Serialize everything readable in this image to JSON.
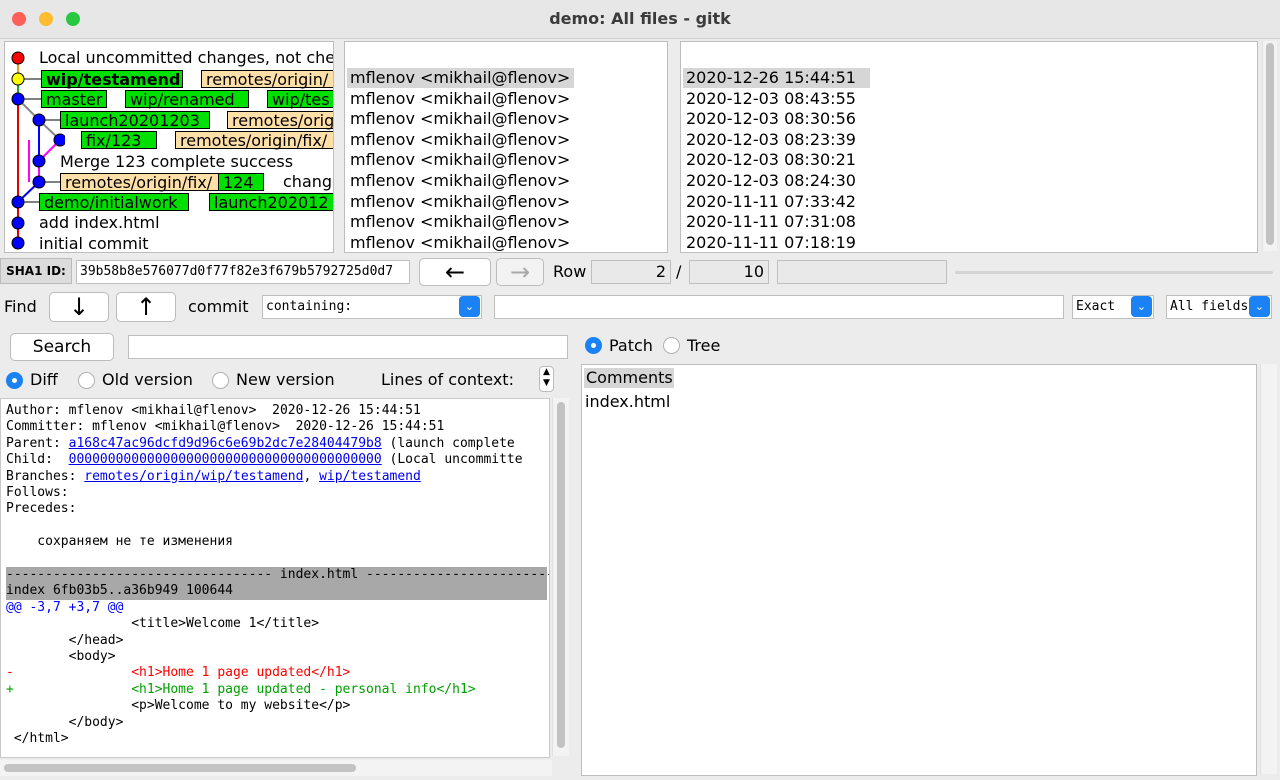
{
  "window": {
    "title": "demo: All files - gitk"
  },
  "commits": [
    {
      "subject": "Local uncommitted changes, not che",
      "author": "",
      "date": ""
    },
    {
      "subject": "",
      "author": "mflenov <mikhail@flenov>",
      "date": "2020-12-26 15:44:51",
      "refs": [
        {
          "label": "wip/testamend",
          "kind": "head"
        },
        {
          "label": "remotes/origin/",
          "kind": "remote"
        }
      ]
    },
    {
      "subject": "",
      "author": "mflenov <mikhail@flenov>",
      "date": "2020-12-03 08:43:55",
      "refs": [
        {
          "label": "master",
          "kind": "head"
        },
        {
          "label": "wip/renamed",
          "kind": "head"
        },
        {
          "label": "wip/tes",
          "kind": "head"
        }
      ]
    },
    {
      "subject": "",
      "author": "mflenov <mikhail@flenov>",
      "date": "2020-12-03 08:30:56",
      "refs": [
        {
          "label": "launch20201203",
          "kind": "head"
        },
        {
          "label": "remotes/origi",
          "kind": "remote"
        }
      ]
    },
    {
      "subject": "",
      "author": "mflenov <mikhail@flenov>",
      "date": "2020-12-03 08:23:39",
      "refs": [
        {
          "label": "fix/123",
          "kind": "head"
        },
        {
          "label": "remotes/origin/fix/",
          "kind": "remote"
        }
      ]
    },
    {
      "subject": "Merge 123 complete success",
      "author": "mflenov <mikhail@flenov>",
      "date": "2020-12-03 08:30:21"
    },
    {
      "subject": "change",
      "author": "mflenov <mikhail@flenov>",
      "date": "2020-12-03 08:24:30",
      "refs": [
        {
          "label": "remotes/origin/fix/",
          "kind": "remote"
        },
        {
          "label": "124",
          "kind": "head"
        }
      ]
    },
    {
      "subject": "",
      "author": "mflenov <mikhail@flenov>",
      "date": "2020-11-11 07:33:42",
      "refs": [
        {
          "label": "demo/initialwork",
          "kind": "head"
        },
        {
          "label": "launch202012",
          "kind": "head"
        }
      ]
    },
    {
      "subject": "add index.html",
      "author": "mflenov <mikhail@flenov>",
      "date": "2020-11-11 07:31:08"
    },
    {
      "subject": "initial commit",
      "author": "mflenov <mikhail@flenov>",
      "date": "2020-11-11 07:18:19"
    }
  ],
  "sha_bar": {
    "label": "SHA1 ID:",
    "value": "39b58b8e576077d0f77f82e3f679b5792725d0d7",
    "back_glyph": "←",
    "forward_glyph": "→",
    "row_label": "Row",
    "row_current": "2",
    "row_sep": "/",
    "row_total": "10"
  },
  "find_bar": {
    "find_label": "Find",
    "down_glyph": "↓",
    "up_glyph": "↑",
    "commit_label": "commit",
    "containing": "containing:",
    "exact": "Exact",
    "all_fields": "All fields"
  },
  "search": {
    "button": "Search"
  },
  "diff_options": {
    "diff": "Diff",
    "old_version": "Old version",
    "new_version": "New version",
    "lines_of_context": "Lines of context:"
  },
  "details": {
    "author_label": "Author:",
    "author": "mflenov <mikhail@flenov>  2020-12-26 15:44:51",
    "committer_label": "Committer:",
    "committer": "mflenov <mikhail@flenov>  2020-12-26 15:44:51",
    "parent_label": "Parent:",
    "parent_sha": "a168c47ac96dcfd9d96c6e69b2dc7e28404479b8",
    "parent_desc": " (launch complete",
    "child_label": "Child:",
    "child_sha": "0000000000000000000000000000000000000000",
    "child_desc": " (Local uncommitte",
    "branches_label": "Branches:",
    "branch1": "remotes/origin/wip/testamend",
    "branch_sep": ", ",
    "branch2": "wip/testamend",
    "follows_label": "Follows:",
    "precedes_label": "Precedes:",
    "message": "    сохраняем не те изменения",
    "file_header": "---------------------------------- index.html -------------------------",
    "index_line": "index 6fb03b5..a36b949 100644",
    "hunk": "@@ -3,7 +3,7 @@",
    "lines": [
      {
        "text": "                <title>Welcome 1</title>",
        "type": "ctx"
      },
      {
        "text": "        </head>",
        "type": "ctx"
      },
      {
        "text": "        <body>",
        "type": "ctx"
      },
      {
        "text": "-               <h1>Home 1 page updated</h1>",
        "type": "del"
      },
      {
        "text": "+               <h1>Home 1 page updated - personal info</h1>",
        "type": "add"
      },
      {
        "text": "                <p>Welcome to my website</p>",
        "type": "ctx"
      },
      {
        "text": "        </body>",
        "type": "ctx"
      },
      {
        "text": " </html>",
        "type": "ctx"
      }
    ]
  },
  "file_view": {
    "patch": "Patch",
    "tree": "Tree",
    "files": [
      "Comments",
      "index.html"
    ]
  },
  "colors": {
    "head_ref": "#00e000",
    "remote_ref": "#ffdfa8",
    "accent": "#1a82f5",
    "added": "#00a000",
    "removed": "#ff0000",
    "hunk": "#0000ff"
  }
}
